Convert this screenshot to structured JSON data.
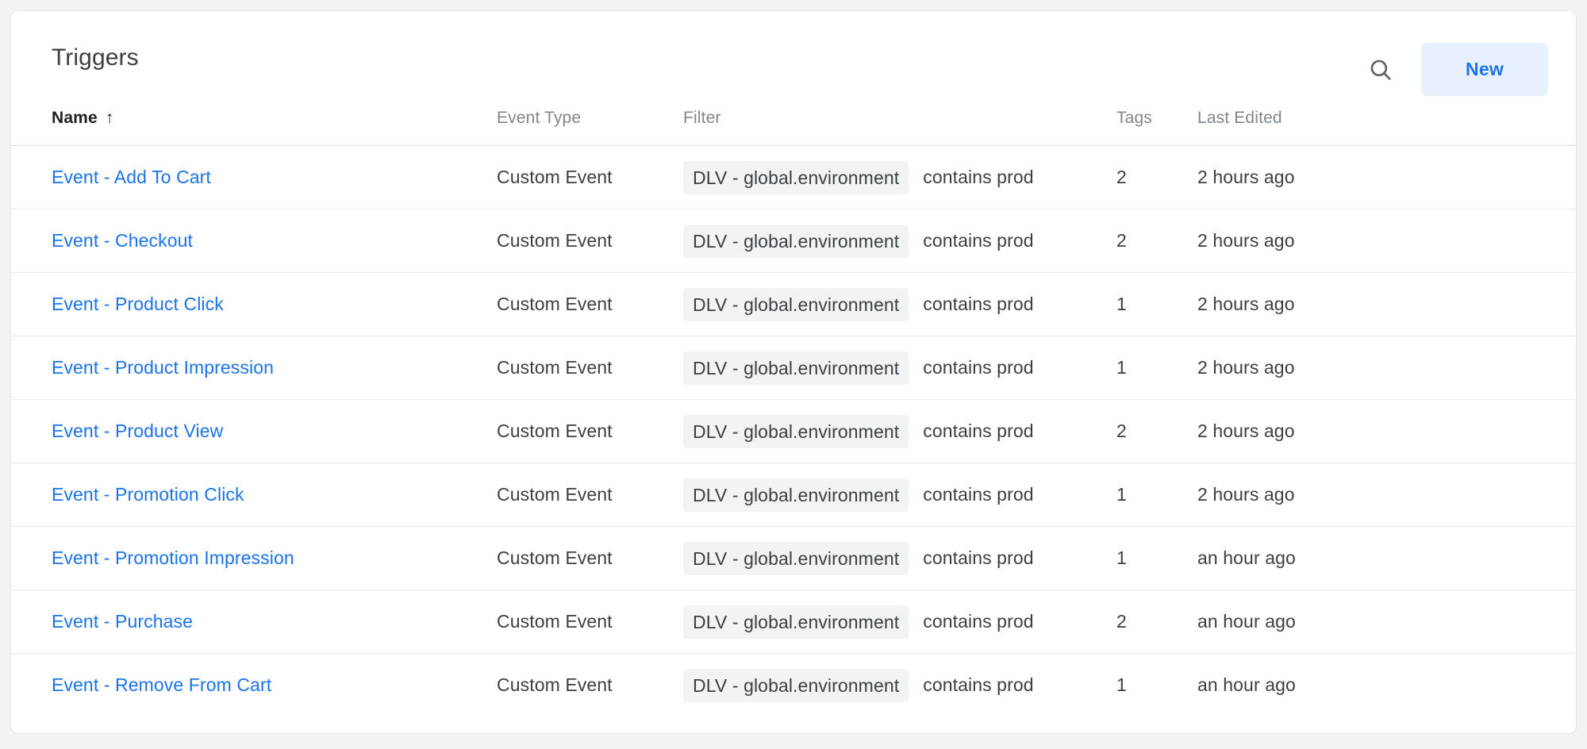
{
  "card": {
    "title": "Triggers",
    "search_icon": "search-icon",
    "new_label": "New",
    "accent_color": "#1a73e8",
    "new_button_bg": "#e8f0fe",
    "chip_bg": "#f1f3f4",
    "page_bg": "#f1f3f4"
  },
  "table": {
    "columns": [
      {
        "key": "name",
        "label": "Name",
        "sorted": true,
        "sort_dir": "↑"
      },
      {
        "key": "type",
        "label": "Event Type",
        "sorted": false
      },
      {
        "key": "filter",
        "label": "Filter",
        "sorted": false
      },
      {
        "key": "tags",
        "label": "Tags",
        "sorted": false
      },
      {
        "key": "edited",
        "label": "Last Edited",
        "sorted": false
      }
    ],
    "rows": [
      {
        "name": "Event - Add To Cart",
        "type": "Custom Event",
        "filter_chip": "DLV - global.environment",
        "filter_op": "contains prod",
        "tags": "2",
        "edited": "2 hours ago"
      },
      {
        "name": "Event - Checkout",
        "type": "Custom Event",
        "filter_chip": "DLV - global.environment",
        "filter_op": "contains prod",
        "tags": "2",
        "edited": "2 hours ago"
      },
      {
        "name": "Event - Product Click",
        "type": "Custom Event",
        "filter_chip": "DLV - global.environment",
        "filter_op": "contains prod",
        "tags": "1",
        "edited": "2 hours ago"
      },
      {
        "name": "Event - Product Impression",
        "type": "Custom Event",
        "filter_chip": "DLV - global.environment",
        "filter_op": "contains prod",
        "tags": "1",
        "edited": "2 hours ago"
      },
      {
        "name": "Event - Product View",
        "type": "Custom Event",
        "filter_chip": "DLV - global.environment",
        "filter_op": "contains prod",
        "tags": "2",
        "edited": "2 hours ago"
      },
      {
        "name": "Event - Promotion Click",
        "type": "Custom Event",
        "filter_chip": "DLV - global.environment",
        "filter_op": "contains prod",
        "tags": "1",
        "edited": "2 hours ago"
      },
      {
        "name": "Event - Promotion Impression",
        "type": "Custom Event",
        "filter_chip": "DLV - global.environment",
        "filter_op": "contains prod",
        "tags": "1",
        "edited": "an hour ago"
      },
      {
        "name": "Event - Purchase",
        "type": "Custom Event",
        "filter_chip": "DLV - global.environment",
        "filter_op": "contains prod",
        "tags": "2",
        "edited": "an hour ago"
      },
      {
        "name": "Event - Remove From Cart",
        "type": "Custom Event",
        "filter_chip": "DLV - global.environment",
        "filter_op": "contains prod",
        "tags": "1",
        "edited": "an hour ago"
      }
    ]
  }
}
